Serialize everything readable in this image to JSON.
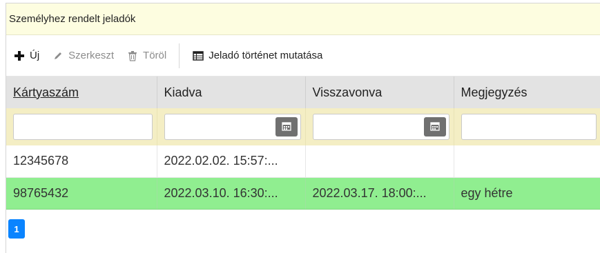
{
  "panel": {
    "title": "Személyhez rendelt jeladók"
  },
  "toolbar": {
    "new_label": "Új",
    "edit_label": "Szerkeszt",
    "delete_label": "Töröl",
    "history_label": "Jeladó történet mutatása"
  },
  "table": {
    "columns": [
      "Kártyaszám",
      "Kiadva",
      "Visszavonva",
      "Megjegyzés"
    ],
    "filters": {
      "card": "",
      "issued": "",
      "revoked": "",
      "note": ""
    },
    "rows": [
      {
        "card": "12345678",
        "issued": "2022.02.02. 15:57:...",
        "revoked": "",
        "note": ""
      },
      {
        "card": "98765432",
        "issued": "2022.03.10. 16:30:...",
        "revoked": "2022.03.17. 18:00:...",
        "note": "egy hétre"
      }
    ]
  },
  "pager": {
    "current": "1"
  },
  "colors": {
    "selected_row": "#90ee90",
    "title_bg": "#fdfde0",
    "filter_bg": "#f4eec4",
    "page_active": "#0a84ff"
  }
}
